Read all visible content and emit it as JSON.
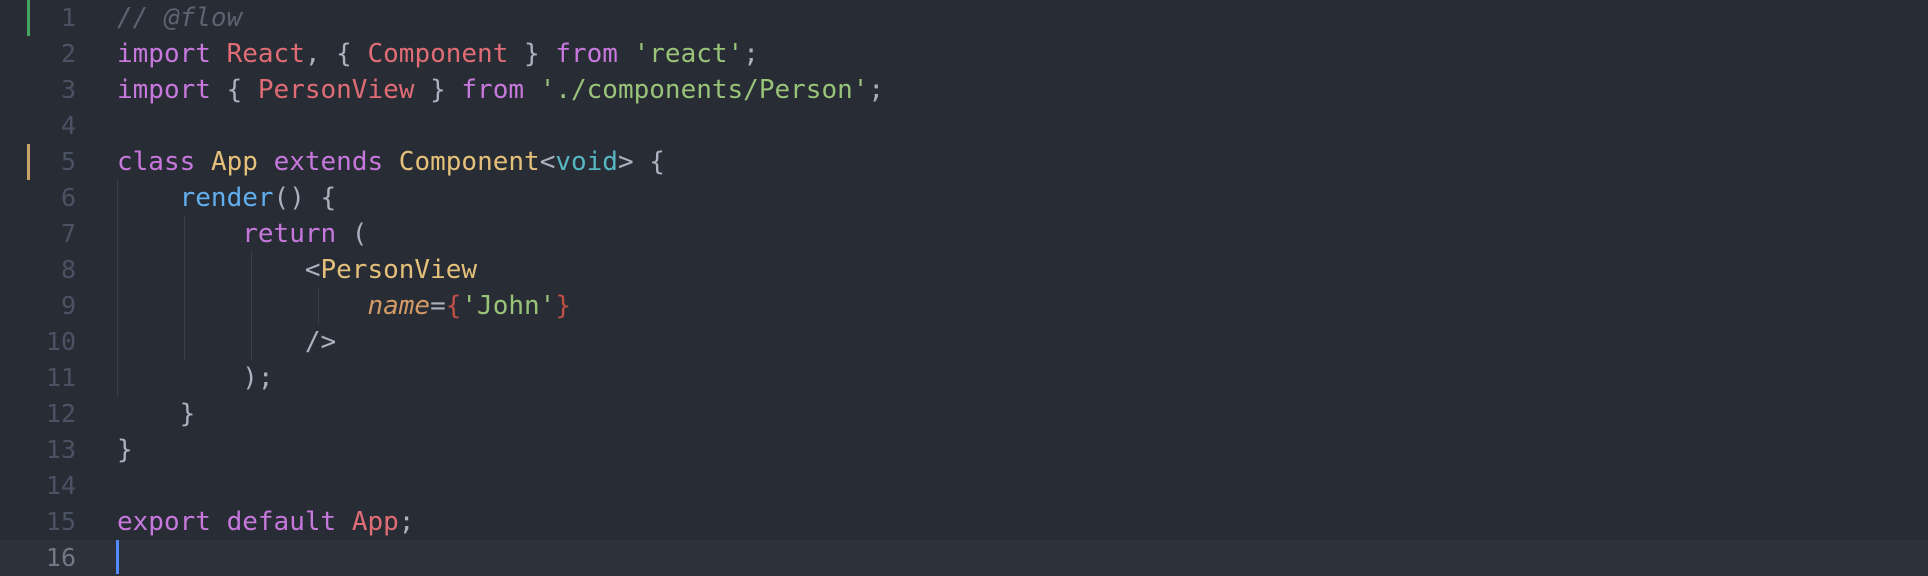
{
  "editor": {
    "active_line": 16,
    "line_numbers": [
      "1",
      "2",
      "3",
      "4",
      "5",
      "6",
      "7",
      "8",
      "9",
      "10",
      "11",
      "12",
      "13",
      "14",
      "15",
      "16"
    ],
    "git_changes": [
      {
        "line": 1,
        "kind": "added"
      },
      {
        "line": 5,
        "kind": "modified"
      }
    ],
    "colors": {
      "background": "#282c34",
      "active_line": "#2c313a",
      "cursor": "#528bff",
      "comment": "#5c6370",
      "keyword": "#c678dd",
      "variable": "#e06c75",
      "class": "#e5c07b",
      "string": "#98c379",
      "function": "#61afef",
      "type": "#56b6c2",
      "attribute": "#d19a66",
      "git_added": "#43a560",
      "git_modified": "#c9a26a"
    },
    "lines": [
      {
        "tokens": [
          {
            "t": "// @flow",
            "k": "comment"
          }
        ]
      },
      {
        "tokens": [
          {
            "t": "import",
            "k": "keyword"
          },
          {
            "t": " ",
            "k": "plain"
          },
          {
            "t": "React",
            "k": "var"
          },
          {
            "t": ", { ",
            "k": "plain"
          },
          {
            "t": "Component",
            "k": "var"
          },
          {
            "t": " } ",
            "k": "plain"
          },
          {
            "t": "from",
            "k": "keyword"
          },
          {
            "t": " ",
            "k": "plain"
          },
          {
            "t": "'react'",
            "k": "string"
          },
          {
            "t": ";",
            "k": "plain"
          }
        ]
      },
      {
        "tokens": [
          {
            "t": "import",
            "k": "keyword"
          },
          {
            "t": " { ",
            "k": "plain"
          },
          {
            "t": "PersonView",
            "k": "var"
          },
          {
            "t": " } ",
            "k": "plain"
          },
          {
            "t": "from",
            "k": "keyword"
          },
          {
            "t": " ",
            "k": "plain"
          },
          {
            "t": "'./components/Person'",
            "k": "string"
          },
          {
            "t": ";",
            "k": "plain"
          }
        ]
      },
      {
        "tokens": []
      },
      {
        "tokens": [
          {
            "t": "class",
            "k": "keyword"
          },
          {
            "t": " ",
            "k": "plain"
          },
          {
            "t": "App",
            "k": "class"
          },
          {
            "t": " ",
            "k": "plain"
          },
          {
            "t": "extends",
            "k": "keyword"
          },
          {
            "t": " ",
            "k": "plain"
          },
          {
            "t": "Component",
            "k": "class"
          },
          {
            "t": "<",
            "k": "plain"
          },
          {
            "t": "void",
            "k": "type"
          },
          {
            "t": "> {",
            "k": "plain"
          }
        ]
      },
      {
        "tokens": [
          {
            "t": "    ",
            "k": "plain"
          },
          {
            "t": "render",
            "k": "func"
          },
          {
            "t": "() {",
            "k": "plain"
          }
        ]
      },
      {
        "tokens": [
          {
            "t": "        ",
            "k": "plain"
          },
          {
            "t": "return",
            "k": "keyword"
          },
          {
            "t": " (",
            "k": "plain"
          }
        ]
      },
      {
        "tokens": [
          {
            "t": "            <",
            "k": "plain"
          },
          {
            "t": "PersonView",
            "k": "class"
          }
        ]
      },
      {
        "tokens": [
          {
            "t": "                ",
            "k": "plain"
          },
          {
            "t": "name",
            "k": "attr"
          },
          {
            "t": "=",
            "k": "plain"
          },
          {
            "t": "{",
            "k": "brace"
          },
          {
            "t": "'John'",
            "k": "string"
          },
          {
            "t": "}",
            "k": "brace"
          }
        ]
      },
      {
        "tokens": [
          {
            "t": "            />",
            "k": "plain"
          }
        ]
      },
      {
        "tokens": [
          {
            "t": "        );",
            "k": "plain"
          }
        ]
      },
      {
        "tokens": [
          {
            "t": "    }",
            "k": "plain"
          }
        ]
      },
      {
        "tokens": [
          {
            "t": "}",
            "k": "plain"
          }
        ]
      },
      {
        "tokens": []
      },
      {
        "tokens": [
          {
            "t": "export",
            "k": "keyword"
          },
          {
            "t": " ",
            "k": "plain"
          },
          {
            "t": "default",
            "k": "keyword"
          },
          {
            "t": " ",
            "k": "plain"
          },
          {
            "t": "App",
            "k": "var"
          },
          {
            "t": ";",
            "k": "plain"
          }
        ]
      },
      {
        "tokens": []
      }
    ]
  }
}
